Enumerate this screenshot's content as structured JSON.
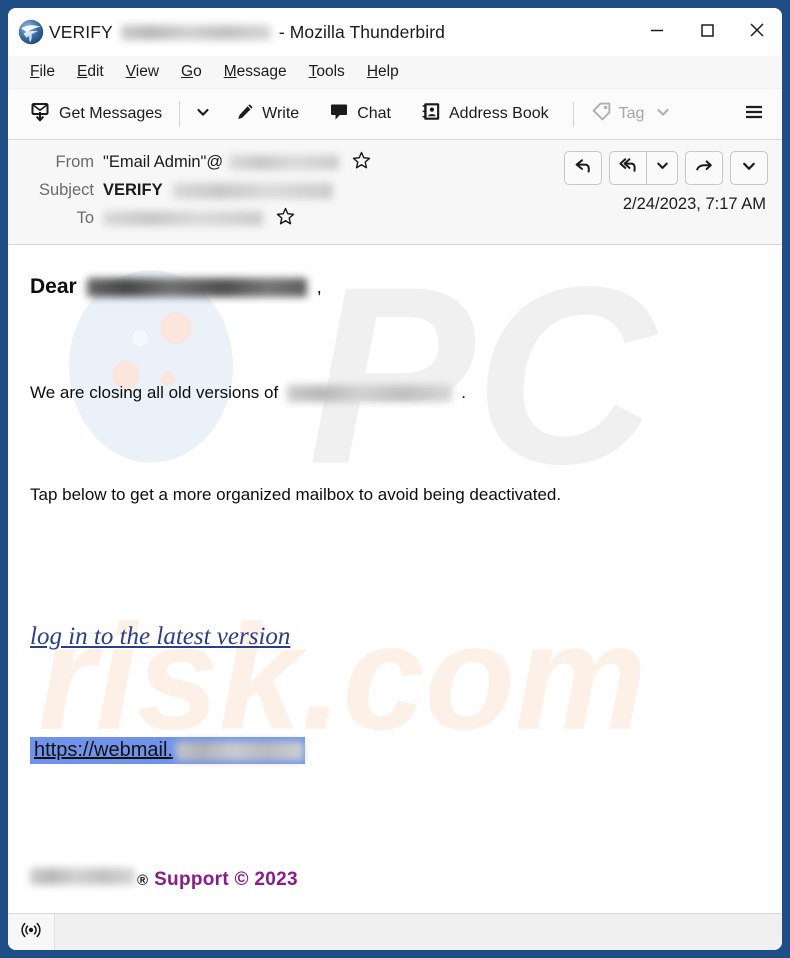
{
  "window": {
    "title_prefix": "VERIFY",
    "title_suffix": "- Mozilla Thunderbird",
    "app_logo_icon": "thunderbird-logo-icon",
    "minimize_icon": "minimize-icon",
    "maximize_icon": "maximize-icon",
    "close_icon": "close-icon",
    "frame_color": "#1f4e87"
  },
  "menubar": {
    "items": [
      {
        "label": "File",
        "accesskey": "F"
      },
      {
        "label": "Edit",
        "accesskey": "E"
      },
      {
        "label": "View",
        "accesskey": "V"
      },
      {
        "label": "Go",
        "accesskey": "G"
      },
      {
        "label": "Message",
        "accesskey": "M"
      },
      {
        "label": "Tools",
        "accesskey": "T"
      },
      {
        "label": "Help",
        "accesskey": "H"
      }
    ]
  },
  "toolbar": {
    "get_messages_label": "Get Messages",
    "get_messages_icon": "get-messages-icon",
    "get_messages_dropdown_icon": "chevron-down-icon",
    "write_label": "Write",
    "write_icon": "pencil-icon",
    "chat_label": "Chat",
    "chat_icon": "chat-bubble-icon",
    "address_book_label": "Address Book",
    "address_book_icon": "address-book-icon",
    "tag_label": "Tag",
    "tag_icon": "tag-icon",
    "tag_dropdown_icon": "chevron-down-icon",
    "app_menu_icon": "hamburger-menu-icon"
  },
  "message_header": {
    "from_label": "From",
    "from_value": "\"Email Admin\"@",
    "from_value_redacted": true,
    "subject_label": "Subject",
    "subject_value": "VERIFY",
    "subject_value_redacted": true,
    "to_label": "To",
    "to_value_redacted": true,
    "date": "2/24/2023, 7:17 AM",
    "star_icon": "star-icon",
    "actions": {
      "reply_icon": "reply-icon",
      "reply_all_icon": "reply-all-icon",
      "reply_all_dropdown_icon": "chevron-down-icon",
      "forward_icon": "forward-icon",
      "more_dropdown_icon": "chevron-down-icon"
    }
  },
  "body": {
    "greeting": "Dear",
    "greeting_redacted": true,
    "greeting_comma": ",",
    "closing_text": "We are closing all old versions of",
    "closing_redacted": true,
    "closing_period": ".",
    "tap_text": "Tap below to get a more organized mailbox to avoid being deactivated.",
    "phish_link_text": "log in to the latest version",
    "phish_link_color": "#2b3f87",
    "url_text": "https://webmail.",
    "url_redacted": true,
    "url_selection_color": "#6f93e8",
    "footer_registered_mark": "®",
    "footer_support": "Support © 2023",
    "footer_support_color": "#8b1a8b",
    "footer_domain_redacted": true,
    "watermark_top": "PC",
    "watermark_bottom": "risk.com",
    "watermark_top_color": "#f0f0f0",
    "watermark_bottom_color": "#fdf0e6"
  },
  "statusbar": {
    "connection_icon": "broadcast-online-icon"
  }
}
